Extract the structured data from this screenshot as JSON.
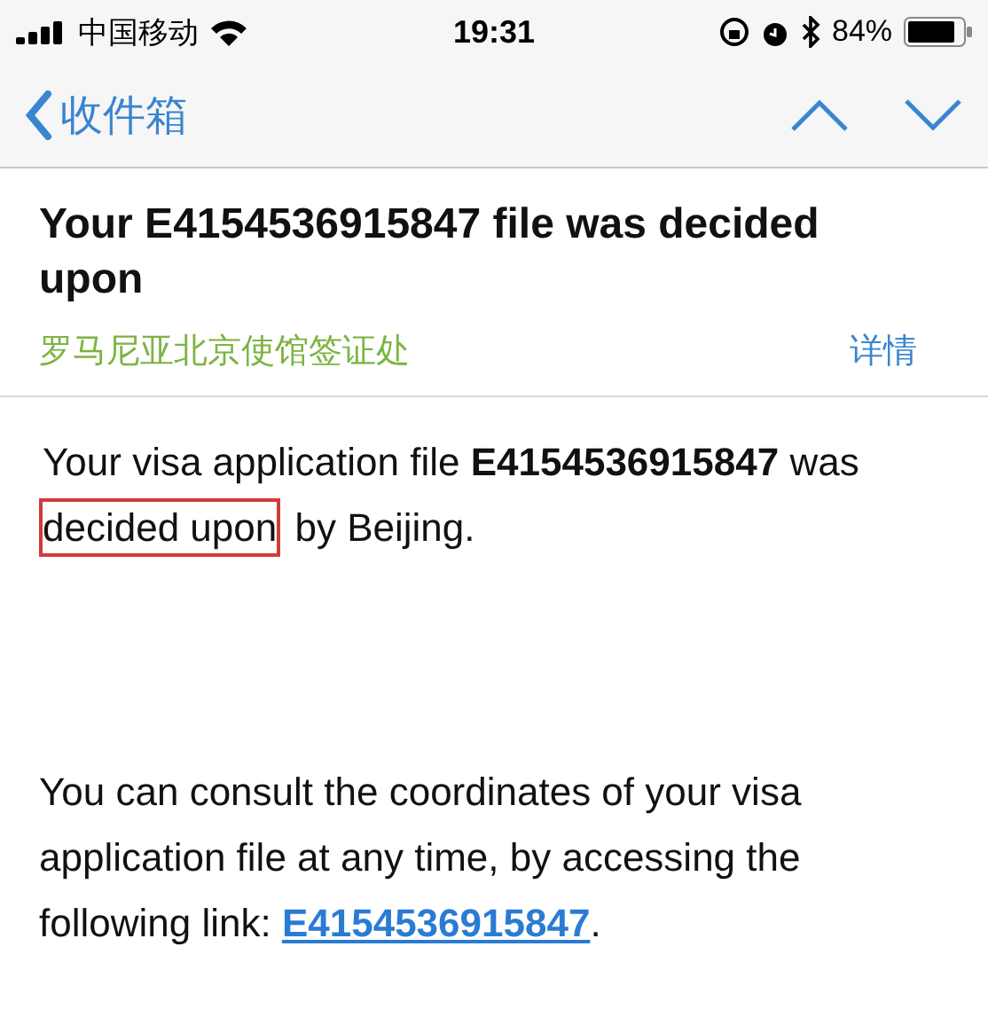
{
  "status_bar": {
    "carrier": "中国移动",
    "time": "19:31",
    "battery": "84%"
  },
  "nav_bar": {
    "back_label": "收件箱"
  },
  "message": {
    "subject": "Your E4154536915847 file was decided upon",
    "sender": "罗马尼亚北京使馆签证处",
    "details_link": "详情",
    "paragraphs": [
      {
        "kind": "text",
        "parts": [
          {
            "text": "Your visa application file **E4154536915847** was ",
            "highlighted": false
          },
          {
            "text": "decided upon",
            "highlighted": true
          },
          {
            "text": " by Beijing.",
            "highlighted": false
          }
        ]
      },
      {
        "kind": "link",
        "text": "You can consult the coordinates of your visa application file at any time, by accessing the following link: ",
        "link": "E4154536915847",
        "after": "."
      }
    ]
  }
}
